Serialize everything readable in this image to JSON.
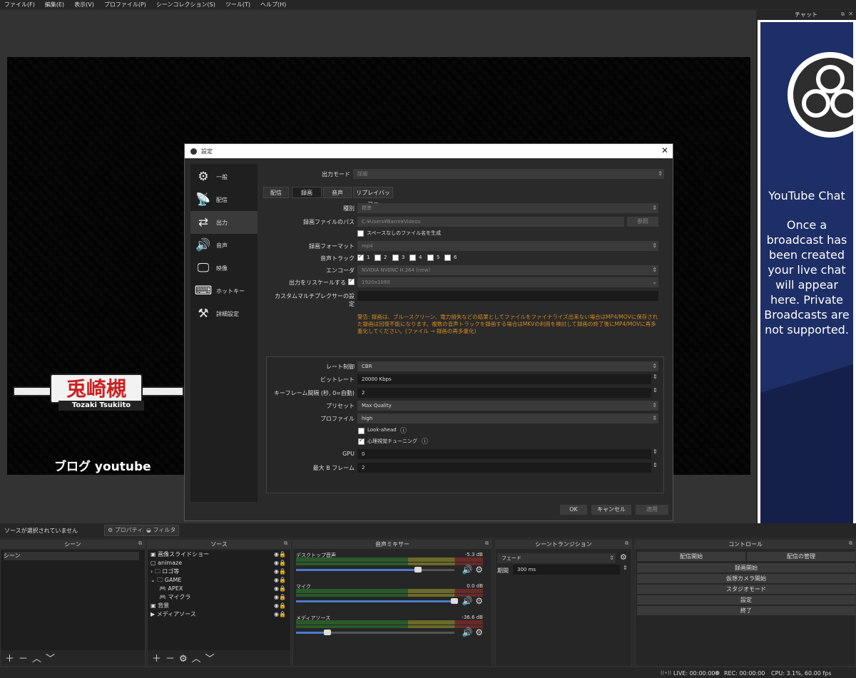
{
  "menu": [
    "ファイル(F)",
    "編集(E)",
    "表示(V)",
    "プロファイル(P)",
    "シーンコレクション(S)",
    "ツール(T)",
    "ヘルプ(H)"
  ],
  "overlay": {
    "name": "兎崎槻",
    "romaji": "Tozaki Tsukiito",
    "blog": "ブログ youtube"
  },
  "chat": {
    "dock_title": "チャット",
    "title": "YouTube Chat",
    "message": "Once a broadcast has been created your live chat will appear here. Private Broadcasts are not supported."
  },
  "dialog": {
    "title": "設定",
    "sidebar": [
      "一般",
      "配信",
      "出力",
      "音声",
      "映像",
      "ホットキー",
      "詳細設定"
    ],
    "output_mode_label": "出力モード",
    "output_mode_value": "詳細",
    "tabs": [
      "配信",
      "録画",
      "音声",
      "リプレイバッファ"
    ],
    "type_label": "種別",
    "type_value": "標準",
    "path_label": "録画ファイルのパス",
    "path_value": "C:¥Users¥Barre¥Videos",
    "browse": "参照",
    "nospace": "スペースなしのファイル名を生成",
    "format_label": "録画フォーマット",
    "format_value": "mp4",
    "tracks_label": "音声トラック",
    "tracks": [
      "1",
      "2",
      "3",
      "4",
      "5",
      "6"
    ],
    "encoder_label": "エンコーダ",
    "encoder_value": "NVIDIA NVENC H.264 (new)",
    "rescale_label": "出力をリスケールする",
    "rescale_value": "1920x1080",
    "muxer_label": "カスタムマルチプレクサーの設定",
    "warning": "警告: 録画は、ブルースクリーン、電力損失などの結果としてファイルをファイナライズ出来ない場合はMP4/MOVに保存された録画は回復不能になります。複数の音声トラックを録画する場合はMKVの利用を検討して録画の終了後にMP4/MOVに再多重化してください。(ファイル → 録画の再多重化)",
    "rate_label": "レート制御",
    "rate_value": "CBR",
    "bitrate_label": "ビットレート",
    "bitrate_value": "20000 Kbps",
    "keyframe_label": "キーフレーム間隔 (秒, 0=自動)",
    "keyframe_value": "2",
    "preset_label": "プリセット",
    "preset_value": "Max Quality",
    "profile_label": "プロファイル",
    "profile_value": "high",
    "lookahead": "Look-ahead",
    "psycho": "心理視覚チューニング",
    "gpu_label": "GPU",
    "gpu_value": "0",
    "bframes_label": "最大 B フレーム",
    "bframes_value": "2",
    "ok": "OK",
    "cancel": "キャンセル",
    "apply": "適用"
  },
  "srcbar": {
    "no_source": "ソースが選択されていません",
    "properties": "プロパティ",
    "filters": "フィルタ"
  },
  "docks": {
    "scenes": {
      "title": "シーン",
      "items": [
        "シーン"
      ]
    },
    "sources": {
      "title": "ソース",
      "items": [
        "画像スライドショー",
        "animaze",
        "ロゴ等",
        "GAME",
        "APEX",
        "マイクラ",
        "背景",
        "メディアソース"
      ]
    },
    "mixer": {
      "title": "音声ミキサー",
      "channels": [
        {
          "name": "デスクトップ音声",
          "db": "-5.3 dB",
          "level": 0.77
        },
        {
          "name": "マイク",
          "db": "0.0 dB",
          "level": 1.0
        },
        {
          "name": "メディアソース",
          "db": "-36.6 dB",
          "level": 0.2
        }
      ]
    },
    "transitions": {
      "title": "シーントランジション",
      "value": "フェード",
      "duration_label": "期間",
      "duration_value": "300 ms"
    },
    "controls": {
      "title": "コントロール",
      "start_stream": "配信開始",
      "manage": "配信の管理",
      "start_rec": "録画開始",
      "virtual_cam": "仮想カメラ開始",
      "studio": "スタジオモード",
      "settings": "設定",
      "exit": "終了"
    }
  },
  "status": {
    "live": "LIVE: 00:00:00",
    "rec": "REC: 00:00:00",
    "cpu": "CPU: 3.1%, 60.00 fps"
  }
}
